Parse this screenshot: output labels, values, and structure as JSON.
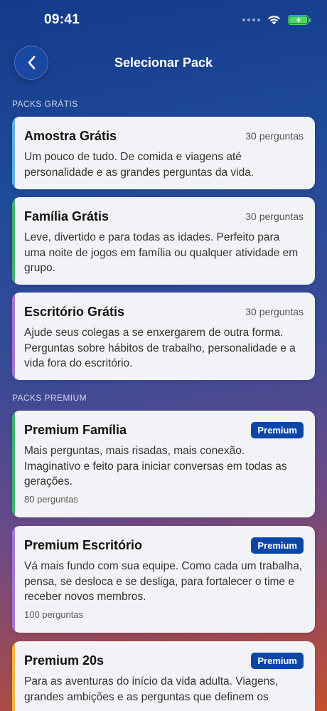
{
  "status_bar": {
    "time": "09:41"
  },
  "nav": {
    "title": "Selecionar Pack"
  },
  "sections": {
    "free_header": "PACKS GRÁTIS",
    "premium_header": "PACKS PREMIUM"
  },
  "free_packs": [
    {
      "title": "Amostra Grátis",
      "count": "30 perguntas",
      "description": "Um pouco de tudo. De comida e viagens até personalidade e as grandes perguntas da vida.",
      "accent": "#5aaee8"
    },
    {
      "title": "Família Grátis",
      "count": "30 perguntas",
      "description": "Leve, divertido e para todas as idades. Perfeito para uma noite de jogos em família ou qualquer atividade em grupo.",
      "accent": "#3fb26d"
    },
    {
      "title": "Escritório Grátis",
      "count": "30 perguntas",
      "description": "Ajude seus colegas a se enxergarem de outra forma. Perguntas sobre hábitos de trabalho, personalidade e a vida fora do escritório.",
      "accent": "#a374d6"
    }
  ],
  "premium_packs": [
    {
      "title": "Premium Família",
      "badge": "Premium",
      "description": "Mais perguntas, mais risadas, mais conexão. Imaginativo e feito para iniciar conversas em todas as gerações.",
      "count": "80 perguntas",
      "accent": "#3fb26d"
    },
    {
      "title": "Premium Escritório",
      "badge": "Premium",
      "description": "Vá mais fundo com sua equipe. Como cada um trabalha, pensa, se desloca e se desliga, para fortalecer o time e receber novos membros.",
      "count": "100 perguntas",
      "accent": "#a374d6"
    },
    {
      "title": "Premium 20s",
      "badge": "Premium",
      "description": "Para as aventuras do início da vida adulta. Viagens, grandes ambições e as perguntas que definem os",
      "accent": "#f2b43a"
    }
  ],
  "colors": {
    "brand_blue": "#0c47a8",
    "card_bg": "#f2f3f6",
    "battery_green": "#4cd964"
  },
  "icons": {
    "back": "chevron-left-icon",
    "signal": "cellular-signal-icon",
    "wifi": "wifi-icon",
    "battery": "battery-charging-icon"
  }
}
